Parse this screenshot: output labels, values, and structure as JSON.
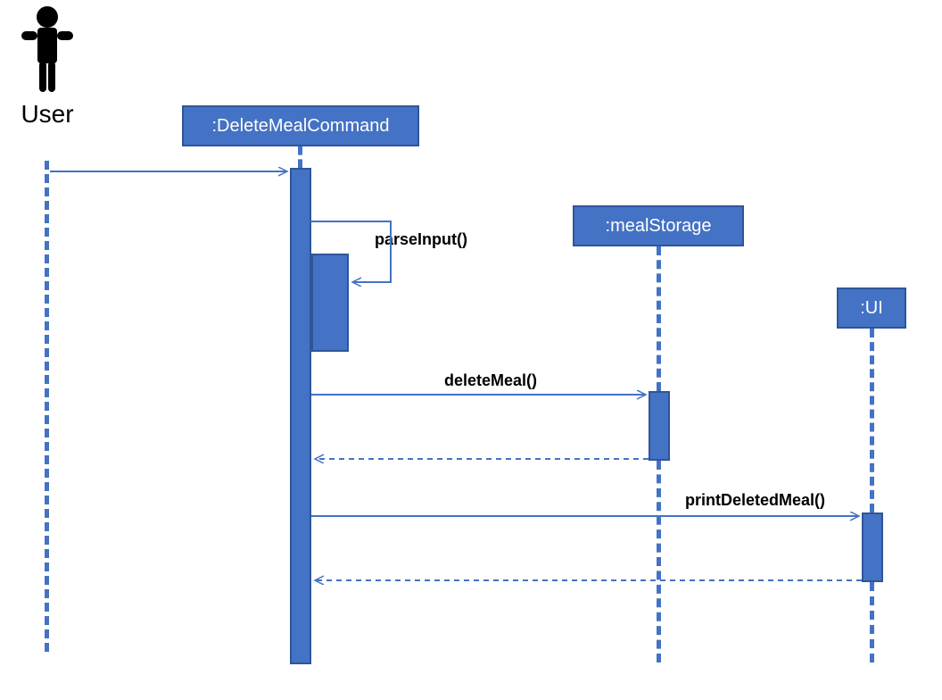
{
  "actor": {
    "label": "User"
  },
  "participants": {
    "deleteMealCommand": ":DeleteMealCommand",
    "mealStorage": ":mealStorage",
    "ui": ":UI"
  },
  "messages": {
    "parseInput": "parseInput()",
    "deleteMeal": "deleteMeal()",
    "printDeletedMeal": "printDeletedMeal()"
  }
}
